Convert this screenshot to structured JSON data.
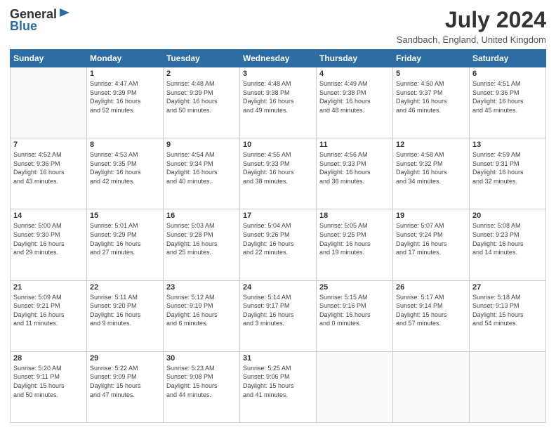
{
  "header": {
    "logo_general": "General",
    "logo_blue": "Blue",
    "month_year": "July 2024",
    "location": "Sandbach, England, United Kingdom"
  },
  "days_of_week": [
    "Sunday",
    "Monday",
    "Tuesday",
    "Wednesday",
    "Thursday",
    "Friday",
    "Saturday"
  ],
  "weeks": [
    [
      {
        "day": "",
        "info": ""
      },
      {
        "day": "1",
        "info": "Sunrise: 4:47 AM\nSunset: 9:39 PM\nDaylight: 16 hours\nand 52 minutes."
      },
      {
        "day": "2",
        "info": "Sunrise: 4:48 AM\nSunset: 9:39 PM\nDaylight: 16 hours\nand 50 minutes."
      },
      {
        "day": "3",
        "info": "Sunrise: 4:48 AM\nSunset: 9:38 PM\nDaylight: 16 hours\nand 49 minutes."
      },
      {
        "day": "4",
        "info": "Sunrise: 4:49 AM\nSunset: 9:38 PM\nDaylight: 16 hours\nand 48 minutes."
      },
      {
        "day": "5",
        "info": "Sunrise: 4:50 AM\nSunset: 9:37 PM\nDaylight: 16 hours\nand 46 minutes."
      },
      {
        "day": "6",
        "info": "Sunrise: 4:51 AM\nSunset: 9:36 PM\nDaylight: 16 hours\nand 45 minutes."
      }
    ],
    [
      {
        "day": "7",
        "info": "Sunrise: 4:52 AM\nSunset: 9:36 PM\nDaylight: 16 hours\nand 43 minutes."
      },
      {
        "day": "8",
        "info": "Sunrise: 4:53 AM\nSunset: 9:35 PM\nDaylight: 16 hours\nand 42 minutes."
      },
      {
        "day": "9",
        "info": "Sunrise: 4:54 AM\nSunset: 9:34 PM\nDaylight: 16 hours\nand 40 minutes."
      },
      {
        "day": "10",
        "info": "Sunrise: 4:55 AM\nSunset: 9:33 PM\nDaylight: 16 hours\nand 38 minutes."
      },
      {
        "day": "11",
        "info": "Sunrise: 4:56 AM\nSunset: 9:33 PM\nDaylight: 16 hours\nand 36 minutes."
      },
      {
        "day": "12",
        "info": "Sunrise: 4:58 AM\nSunset: 9:32 PM\nDaylight: 16 hours\nand 34 minutes."
      },
      {
        "day": "13",
        "info": "Sunrise: 4:59 AM\nSunset: 9:31 PM\nDaylight: 16 hours\nand 32 minutes."
      }
    ],
    [
      {
        "day": "14",
        "info": "Sunrise: 5:00 AM\nSunset: 9:30 PM\nDaylight: 16 hours\nand 29 minutes."
      },
      {
        "day": "15",
        "info": "Sunrise: 5:01 AM\nSunset: 9:29 PM\nDaylight: 16 hours\nand 27 minutes."
      },
      {
        "day": "16",
        "info": "Sunrise: 5:03 AM\nSunset: 9:28 PM\nDaylight: 16 hours\nand 25 minutes."
      },
      {
        "day": "17",
        "info": "Sunrise: 5:04 AM\nSunset: 9:26 PM\nDaylight: 16 hours\nand 22 minutes."
      },
      {
        "day": "18",
        "info": "Sunrise: 5:05 AM\nSunset: 9:25 PM\nDaylight: 16 hours\nand 19 minutes."
      },
      {
        "day": "19",
        "info": "Sunrise: 5:07 AM\nSunset: 9:24 PM\nDaylight: 16 hours\nand 17 minutes."
      },
      {
        "day": "20",
        "info": "Sunrise: 5:08 AM\nSunset: 9:23 PM\nDaylight: 16 hours\nand 14 minutes."
      }
    ],
    [
      {
        "day": "21",
        "info": "Sunrise: 5:09 AM\nSunset: 9:21 PM\nDaylight: 16 hours\nand 11 minutes."
      },
      {
        "day": "22",
        "info": "Sunrise: 5:11 AM\nSunset: 9:20 PM\nDaylight: 16 hours\nand 9 minutes."
      },
      {
        "day": "23",
        "info": "Sunrise: 5:12 AM\nSunset: 9:19 PM\nDaylight: 16 hours\nand 6 minutes."
      },
      {
        "day": "24",
        "info": "Sunrise: 5:14 AM\nSunset: 9:17 PM\nDaylight: 16 hours\nand 3 minutes."
      },
      {
        "day": "25",
        "info": "Sunrise: 5:15 AM\nSunset: 9:16 PM\nDaylight: 16 hours\nand 0 minutes."
      },
      {
        "day": "26",
        "info": "Sunrise: 5:17 AM\nSunset: 9:14 PM\nDaylight: 15 hours\nand 57 minutes."
      },
      {
        "day": "27",
        "info": "Sunrise: 5:18 AM\nSunset: 9:13 PM\nDaylight: 15 hours\nand 54 minutes."
      }
    ],
    [
      {
        "day": "28",
        "info": "Sunrise: 5:20 AM\nSunset: 9:11 PM\nDaylight: 15 hours\nand 50 minutes."
      },
      {
        "day": "29",
        "info": "Sunrise: 5:22 AM\nSunset: 9:09 PM\nDaylight: 15 hours\nand 47 minutes."
      },
      {
        "day": "30",
        "info": "Sunrise: 5:23 AM\nSunset: 9:08 PM\nDaylight: 15 hours\nand 44 minutes."
      },
      {
        "day": "31",
        "info": "Sunrise: 5:25 AM\nSunset: 9:06 PM\nDaylight: 15 hours\nand 41 minutes."
      },
      {
        "day": "",
        "info": ""
      },
      {
        "day": "",
        "info": ""
      },
      {
        "day": "",
        "info": ""
      }
    ]
  ]
}
